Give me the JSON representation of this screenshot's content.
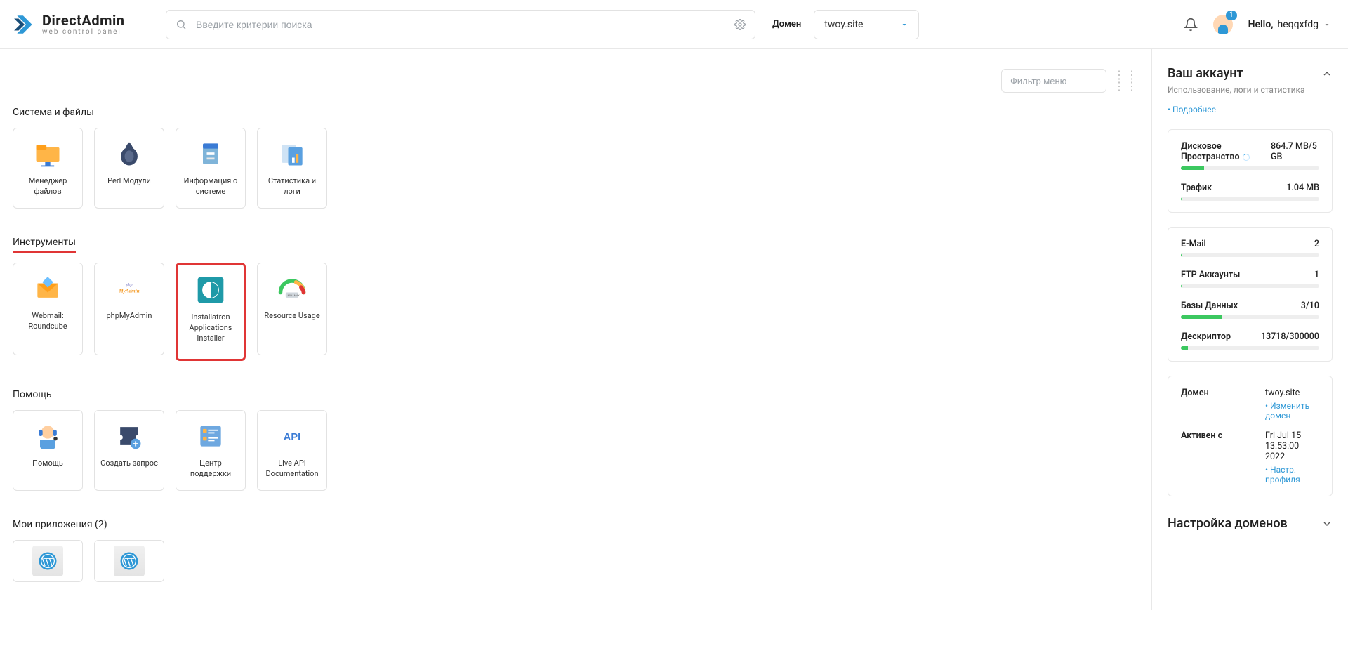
{
  "brand": {
    "title": "DirectAdmin",
    "subtitle": "web control panel"
  },
  "search": {
    "placeholder": "Введите критерии поиска"
  },
  "domain": {
    "label": "Домен",
    "current": "twoy.site"
  },
  "notifications": {
    "count": "1"
  },
  "user": {
    "greeting": "Hello,",
    "name": "heqqxfdg"
  },
  "menu_filter": {
    "placeholder": "Фильтр меню"
  },
  "sections": {
    "system": {
      "title": "Система и файлы",
      "tiles": [
        {
          "id": "file-manager",
          "label": "Менеджер файлов"
        },
        {
          "id": "perl-modules",
          "label": "Perl Модули"
        },
        {
          "id": "system-info",
          "label": "Информация о системе"
        },
        {
          "id": "stats-logs",
          "label": "Статистика и логи"
        }
      ]
    },
    "tools": {
      "title": "Инструменты",
      "tiles": [
        {
          "id": "roundcube",
          "label": "Webmail: Roundcube"
        },
        {
          "id": "phpmyadmin",
          "label": "phpMyAdmin"
        },
        {
          "id": "installatron",
          "label": "Installatron Applications Installer",
          "highlight": true
        },
        {
          "id": "resource-usage",
          "label": "Resource Usage"
        }
      ]
    },
    "help": {
      "title": "Помощь",
      "tiles": [
        {
          "id": "help",
          "label": "Помощь"
        },
        {
          "id": "create-ticket",
          "label": "Создать запрос"
        },
        {
          "id": "support-center",
          "label": "Центр поддержки"
        },
        {
          "id": "api-docs",
          "label": "Live API Documentation"
        }
      ]
    },
    "apps": {
      "title": "Мои приложения (2)"
    }
  },
  "account": {
    "title": "Ваш аккаунт",
    "subtitle": "Использование, логи и статистика",
    "more": "Подробнее",
    "metrics": [
      {
        "id": "disk",
        "label": "Дисковое Пространство",
        "value": "864.7 MB/5 GB",
        "pct": 17,
        "spinner": true
      },
      {
        "id": "traffic",
        "label": "Трафик",
        "value": "1.04 MB",
        "pct": 1
      },
      {
        "id": "email",
        "label": "E-Mail",
        "value": "2",
        "pct": 1
      },
      {
        "id": "ftp",
        "label": "FTP Аккаунты",
        "value": "1",
        "pct": 1
      },
      {
        "id": "db",
        "label": "Базы Данных",
        "value": "3/10",
        "pct": 30
      },
      {
        "id": "fd",
        "label": "Дескриптор",
        "value": "13718/300000",
        "pct": 5
      }
    ],
    "domain_block": {
      "domain_label": "Домен",
      "domain_value": "twoy.site",
      "change_domain": "Изменить домен",
      "active_label": "Активен с",
      "active_value": "Fri Jul 15 13:53:00 2022",
      "profile_settings": "Настр. профиля"
    }
  },
  "domain_settings": {
    "title": "Настройка доменов"
  }
}
